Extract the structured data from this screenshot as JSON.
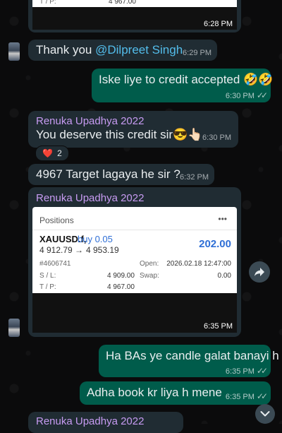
{
  "top_card": {
    "tp_label": "T / P:",
    "tp_value": "4 967.00",
    "time": "6:28 PM"
  },
  "messages": {
    "m1": {
      "prefix": "Thank you ",
      "mention": "@Dilpreet Singh",
      "time": "6:29 PM"
    },
    "m2": {
      "text": "Iske liye to credit accepted 🤣🤣",
      "time": "6:30 PM"
    },
    "m3": {
      "sender": "Renuka Upadhya 2022",
      "text": "You deserve this credit sir😎👆🏻",
      "time": "6:30 PM",
      "reaction_emoji": "❤️",
      "reaction_count": "2"
    },
    "m4": {
      "text": "4967 Target lagaya he sir ?",
      "time": "6:32 PM"
    },
    "m5": {
      "sender": "Renuka Upadhya 2022",
      "time": "6:35 PM"
    },
    "m6": {
      "text": "Ha BAs ye candle galat banayi h",
      "time": "6:35 PM"
    },
    "m7": {
      "text": "Adha  book kr liya h mene",
      "time": "6:35 PM"
    },
    "m8": {
      "sender": "Renuka Upadhya 2022"
    }
  },
  "positions_card": {
    "title": "Positions",
    "menu": "•••",
    "symbol": "XAUUSD.f,",
    "side": "buy 0.05",
    "price_from": "4 912.79",
    "arrow": "→",
    "price_to": "4 953.19",
    "profit": "202.00",
    "ticket": "#4606741",
    "open_label": "Open:",
    "open_value": "2026.02.18 12:47:00",
    "sl_label": "S / L:",
    "sl_value": "4 909.00",
    "swap_label": "Swap:",
    "swap_value": "0.00",
    "tp_label": "T / P:",
    "tp_value": "4 967.00"
  },
  "icons": {
    "forward": "forward-icon",
    "scroll_down": "chevron-down-icon",
    "read_ticks": "double-check-icon"
  },
  "colors": {
    "incoming_bubble": "#202c33",
    "outgoing_bubble": "#005c4b",
    "sender_name": "#c79bf2",
    "mention": "#53bdeb",
    "profit": "#2f6fd6"
  }
}
